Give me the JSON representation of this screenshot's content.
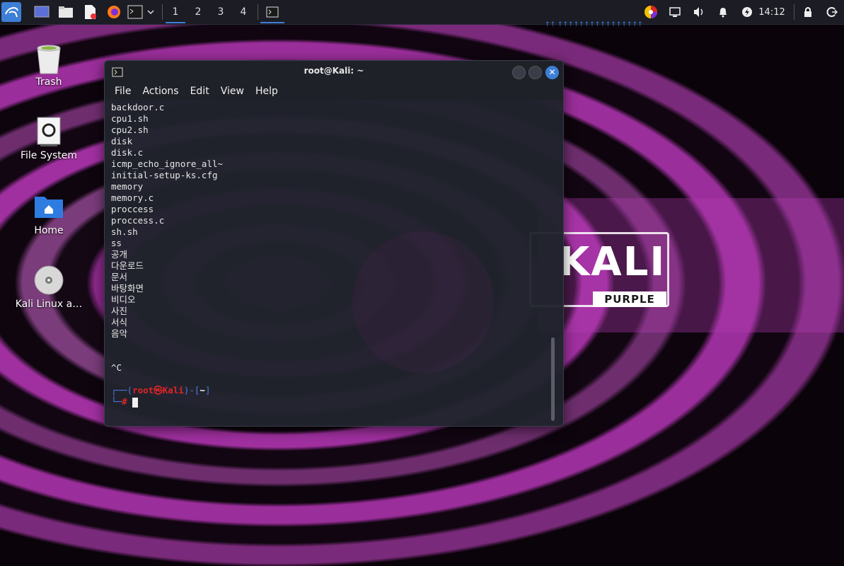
{
  "taskbar": {
    "workspaces": [
      "1",
      "2",
      "3",
      "4"
    ],
    "clock": "14:12",
    "icons": [
      "kali-menu-icon",
      "show-desktop-icon",
      "file-manager-icon",
      "text-editor-icon",
      "firefox-icon",
      "terminal-icon",
      "dropdown-chevron-icon",
      "terminal-window-icon",
      "color-picker-icon",
      "screen-icon",
      "volume-icon",
      "notifications-icon",
      "power-icon",
      "lock-icon",
      "logout-icon"
    ]
  },
  "desktop": {
    "icons": [
      {
        "label": "Trash",
        "icon": "trash-icon"
      },
      {
        "label": "File System",
        "icon": "drive-icon"
      },
      {
        "label": "Home",
        "icon": "home-folder-icon"
      },
      {
        "label": "Kali Linux a…",
        "icon": "disc-icon"
      }
    ]
  },
  "wallpaper": {
    "brand": "KALI",
    "subbrand": "PURPLE",
    "strip_text": "↑↑ ↑↑↑↑↑↑↑↑↑↑↑↑↑↑↑↑"
  },
  "terminal": {
    "title": "root@Kali: ~",
    "menu": [
      "File",
      "Actions",
      "Edit",
      "View",
      "Help"
    ],
    "lines": [
      "backdoor.c",
      "cpu1.sh",
      "cpu2.sh",
      "disk",
      "disk.c",
      "icmp_echo_ignore_all~",
      "initial-setup-ks.cfg",
      "memory",
      "memory.c",
      "proccess",
      "proccess.c",
      "sh.sh",
      "ss",
      "공개",
      "다운로드",
      "문서",
      "바탕화면",
      "비디오",
      "사진",
      "서식",
      "음악",
      "",
      "",
      "^C",
      ""
    ],
    "prompt": {
      "bracket_open": "┌──(",
      "user_host": "root㉿Kali",
      "bracket_mid": ")-[",
      "path": "~",
      "bracket_close": "]",
      "second_line": "└─",
      "symbol": "#"
    }
  },
  "colors": {
    "accent": "#3d7fd6",
    "prompt_red": "#e02424",
    "prompt_blue": "#4f7ae0",
    "taskbar_bg": "#1b1c24",
    "terminal_bg": "#20232d"
  }
}
